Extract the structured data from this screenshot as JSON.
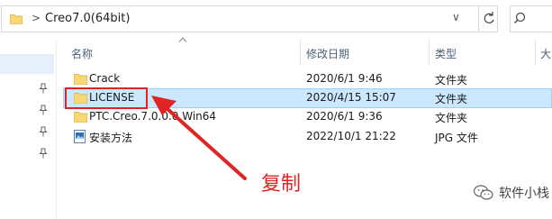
{
  "address": {
    "separator": ">",
    "path": "Creo7.0(64bit)",
    "chevron": "∨"
  },
  "columns": {
    "name": "名称",
    "modified": "修改日期",
    "type": "类型",
    "size": "大"
  },
  "files": [
    {
      "name": "Crack",
      "date": "2020/6/1 9:46",
      "type": "文件夹",
      "icon": "folder-icon"
    },
    {
      "name": "LICENSE",
      "date": "2020/4/15 15:07",
      "type": "文件夹",
      "icon": "folder-icon"
    },
    {
      "name": "PTC.Creo.7.0.0.0.Win64",
      "date": "2020/6/1 9:36",
      "type": "文件夹",
      "icon": "folder-icon"
    },
    {
      "name": "安装方法",
      "date": "2022/10/1 21:22",
      "type": "JPG 文件",
      "icon": "image-file-icon"
    }
  ],
  "annotation": {
    "label": "复制",
    "color": "#e02424"
  },
  "watermark": {
    "text": "软件小栈"
  },
  "colors": {
    "selected_row": "#cce8ff",
    "folder": "#f8d775",
    "header_text": "#4c607a"
  }
}
